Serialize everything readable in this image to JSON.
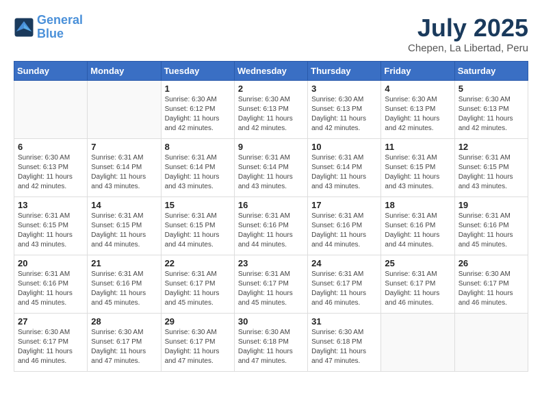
{
  "header": {
    "logo_line1": "General",
    "logo_line2": "Blue",
    "title": "July 2025",
    "subtitle": "Chepen, La Libertad, Peru"
  },
  "weekdays": [
    "Sunday",
    "Monday",
    "Tuesday",
    "Wednesday",
    "Thursday",
    "Friday",
    "Saturday"
  ],
  "weeks": [
    [
      {
        "day": "",
        "info": ""
      },
      {
        "day": "",
        "info": ""
      },
      {
        "day": "1",
        "sunrise": "6:30 AM",
        "sunset": "6:12 PM",
        "daylight": "11 hours and 42 minutes."
      },
      {
        "day": "2",
        "sunrise": "6:30 AM",
        "sunset": "6:13 PM",
        "daylight": "11 hours and 42 minutes."
      },
      {
        "day": "3",
        "sunrise": "6:30 AM",
        "sunset": "6:13 PM",
        "daylight": "11 hours and 42 minutes."
      },
      {
        "day": "4",
        "sunrise": "6:30 AM",
        "sunset": "6:13 PM",
        "daylight": "11 hours and 42 minutes."
      },
      {
        "day": "5",
        "sunrise": "6:30 AM",
        "sunset": "6:13 PM",
        "daylight": "11 hours and 42 minutes."
      }
    ],
    [
      {
        "day": "6",
        "sunrise": "6:30 AM",
        "sunset": "6:13 PM",
        "daylight": "11 hours and 42 minutes."
      },
      {
        "day": "7",
        "sunrise": "6:31 AM",
        "sunset": "6:14 PM",
        "daylight": "11 hours and 43 minutes."
      },
      {
        "day": "8",
        "sunrise": "6:31 AM",
        "sunset": "6:14 PM",
        "daylight": "11 hours and 43 minutes."
      },
      {
        "day": "9",
        "sunrise": "6:31 AM",
        "sunset": "6:14 PM",
        "daylight": "11 hours and 43 minutes."
      },
      {
        "day": "10",
        "sunrise": "6:31 AM",
        "sunset": "6:14 PM",
        "daylight": "11 hours and 43 minutes."
      },
      {
        "day": "11",
        "sunrise": "6:31 AM",
        "sunset": "6:15 PM",
        "daylight": "11 hours and 43 minutes."
      },
      {
        "day": "12",
        "sunrise": "6:31 AM",
        "sunset": "6:15 PM",
        "daylight": "11 hours and 43 minutes."
      }
    ],
    [
      {
        "day": "13",
        "sunrise": "6:31 AM",
        "sunset": "6:15 PM",
        "daylight": "11 hours and 43 minutes."
      },
      {
        "day": "14",
        "sunrise": "6:31 AM",
        "sunset": "6:15 PM",
        "daylight": "11 hours and 44 minutes."
      },
      {
        "day": "15",
        "sunrise": "6:31 AM",
        "sunset": "6:15 PM",
        "daylight": "11 hours and 44 minutes."
      },
      {
        "day": "16",
        "sunrise": "6:31 AM",
        "sunset": "6:16 PM",
        "daylight": "11 hours and 44 minutes."
      },
      {
        "day": "17",
        "sunrise": "6:31 AM",
        "sunset": "6:16 PM",
        "daylight": "11 hours and 44 minutes."
      },
      {
        "day": "18",
        "sunrise": "6:31 AM",
        "sunset": "6:16 PM",
        "daylight": "11 hours and 44 minutes."
      },
      {
        "day": "19",
        "sunrise": "6:31 AM",
        "sunset": "6:16 PM",
        "daylight": "11 hours and 45 minutes."
      }
    ],
    [
      {
        "day": "20",
        "sunrise": "6:31 AM",
        "sunset": "6:16 PM",
        "daylight": "11 hours and 45 minutes."
      },
      {
        "day": "21",
        "sunrise": "6:31 AM",
        "sunset": "6:16 PM",
        "daylight": "11 hours and 45 minutes."
      },
      {
        "day": "22",
        "sunrise": "6:31 AM",
        "sunset": "6:17 PM",
        "daylight": "11 hours and 45 minutes."
      },
      {
        "day": "23",
        "sunrise": "6:31 AM",
        "sunset": "6:17 PM",
        "daylight": "11 hours and 45 minutes."
      },
      {
        "day": "24",
        "sunrise": "6:31 AM",
        "sunset": "6:17 PM",
        "daylight": "11 hours and 46 minutes."
      },
      {
        "day": "25",
        "sunrise": "6:31 AM",
        "sunset": "6:17 PM",
        "daylight": "11 hours and 46 minutes."
      },
      {
        "day": "26",
        "sunrise": "6:30 AM",
        "sunset": "6:17 PM",
        "daylight": "11 hours and 46 minutes."
      }
    ],
    [
      {
        "day": "27",
        "sunrise": "6:30 AM",
        "sunset": "6:17 PM",
        "daylight": "11 hours and 46 minutes."
      },
      {
        "day": "28",
        "sunrise": "6:30 AM",
        "sunset": "6:17 PM",
        "daylight": "11 hours and 47 minutes."
      },
      {
        "day": "29",
        "sunrise": "6:30 AM",
        "sunset": "6:17 PM",
        "daylight": "11 hours and 47 minutes."
      },
      {
        "day": "30",
        "sunrise": "6:30 AM",
        "sunset": "6:18 PM",
        "daylight": "11 hours and 47 minutes."
      },
      {
        "day": "31",
        "sunrise": "6:30 AM",
        "sunset": "6:18 PM",
        "daylight": "11 hours and 47 minutes."
      },
      {
        "day": "",
        "info": ""
      },
      {
        "day": "",
        "info": ""
      }
    ]
  ]
}
